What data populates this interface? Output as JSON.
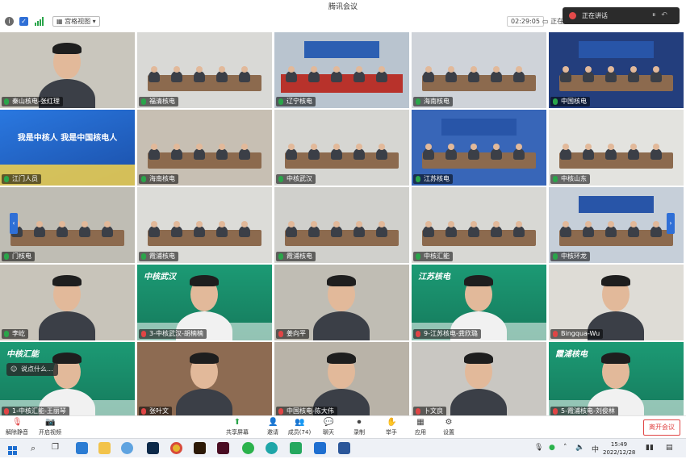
{
  "window": {
    "title": "腾讯会议"
  },
  "infobar": {
    "view_mode": "宫格视图",
    "timer": "02:29:05",
    "speaker": "正在讲话："
  },
  "recording": {
    "label": "正在讲话",
    "controls": "⏸ ↶"
  },
  "tiles": [
    {
      "name": "秦山核电-张红理",
      "muted": false,
      "scene": "person",
      "wall": "#c9c6bd"
    },
    {
      "name": "福清核电",
      "muted": false,
      "scene": "room",
      "wall": "#d9d9d6"
    },
    {
      "name": "辽宁核电",
      "muted": false,
      "scene": "room-red",
      "wall": "#b9c4cf"
    },
    {
      "name": "海南核电",
      "muted": false,
      "scene": "room",
      "wall": "#cfd3d9"
    },
    {
      "name": "中国核电",
      "muted": false,
      "scene": "room-blue",
      "wall": "#233e7d"
    },
    {
      "name": "江门人员",
      "muted": false,
      "scene": "poster",
      "wall": "#1e5fc3",
      "poster_text": "我是中核人 我是中国核电人"
    },
    {
      "name": "海南核电",
      "muted": false,
      "scene": "room",
      "wall": "#c7bfb3"
    },
    {
      "name": "中核武汉",
      "muted": false,
      "scene": "room",
      "wall": "#d6d6d2"
    },
    {
      "name": "江苏核电",
      "muted": false,
      "scene": "room-blue",
      "wall": "#3866b8"
    },
    {
      "name": "中核山东",
      "muted": false,
      "scene": "room",
      "wall": "#e3e3df"
    },
    {
      "name": "门核电",
      "muted": false,
      "scene": "room",
      "wall": "#bfbdb4"
    },
    {
      "name": "霞浦核电",
      "muted": false,
      "scene": "room",
      "wall": "#dcdcd8"
    },
    {
      "name": "霞浦核电",
      "muted": false,
      "scene": "room",
      "wall": "#d0d0cc"
    },
    {
      "name": "中核汇能",
      "muted": false,
      "scene": "room",
      "wall": "#d8d8d4"
    },
    {
      "name": "中核环龙",
      "muted": false,
      "scene": "room-blue",
      "wall": "#c6cfd9"
    },
    {
      "name": "李屹",
      "muted": false,
      "scene": "person",
      "wall": "#c8c4ba"
    },
    {
      "name": "3-中核武汉-胡楠楠",
      "muted": true,
      "scene": "person-green",
      "wall": "#1c9a74",
      "brand": "中核武汉"
    },
    {
      "name": "姜向平",
      "muted": true,
      "scene": "person",
      "wall": "#c0bdb4"
    },
    {
      "name": "9-江苏核电-龚欣璐",
      "muted": true,
      "scene": "person-green",
      "wall": "#1c9a74",
      "brand": "江苏核电"
    },
    {
      "name": "Bingqua-Wu",
      "muted": true,
      "scene": "person",
      "wall": "#dedcd6"
    },
    {
      "name": "1-中核汇能-王丽琴",
      "muted": true,
      "scene": "person-green",
      "wall": "#1c9a74",
      "brand": "中核汇能"
    },
    {
      "name": "张叶文",
      "muted": true,
      "scene": "person",
      "wall": "#8d6b52"
    },
    {
      "name": "中国核电-陈大伟",
      "muted": true,
      "scene": "person",
      "wall": "#b9b3a8"
    },
    {
      "name": "卜文良",
      "muted": true,
      "scene": "person",
      "wall": "#c9c7c2"
    },
    {
      "name": "5-霞浦核电-刘俊林",
      "muted": true,
      "scene": "person-green",
      "wall": "#1c9a74",
      "brand": "霞浦核电"
    }
  ],
  "reaction_bubble": {
    "label": "说点什么..."
  },
  "toolbar": {
    "mic_label": "解除静音",
    "video_label": "开启视频",
    "share_label": "共享屏幕",
    "invite_label": "邀请",
    "members_label": "成员(74)",
    "chat_label": "聊天",
    "record_label": "录制",
    "hand_label": "举手",
    "apps_label": "应用",
    "settings_label": "设置",
    "end_label": "离开会议"
  },
  "taskbar": {
    "time": "15:49",
    "date": "2022/12/28",
    "ime": "中"
  },
  "colors": {
    "accent_red": "#e04545",
    "brand_green": "#1c9a74",
    "brand_blue": "#1e5fc3"
  }
}
